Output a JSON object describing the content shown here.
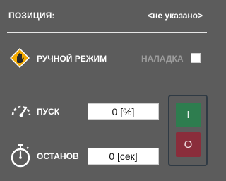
{
  "position": {
    "label": "ПОЗИЦИЯ:",
    "value": "<не указано>"
  },
  "mode": {
    "manual_label": "РУЧНОЙ РЕЖИМ",
    "manual_icon": "hand-warning-icon",
    "setup_label": "НАЛАДКА",
    "setup_checked": false
  },
  "start": {
    "label": "ПУСК",
    "icon": "gauge-icon",
    "value": "0 [%]"
  },
  "stop": {
    "label": "ОСТАНОВ",
    "icon": "stopwatch-icon",
    "value": "0 [сек]"
  },
  "controls": {
    "on_label": "I",
    "off_label": "O",
    "on_color": "#2e7d4f",
    "off_color": "#8a2d3b"
  }
}
